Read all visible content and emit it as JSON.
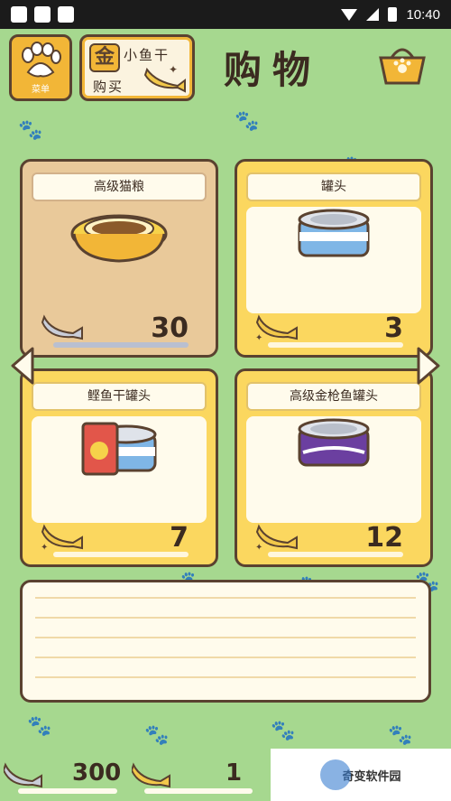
{
  "status_bar": {
    "time": "10:40"
  },
  "header": {
    "menu_label": "菜单",
    "buy_badge": "金",
    "buy_line1": "小鱼干",
    "buy_line2": "购买",
    "title": "购物"
  },
  "items": [
    {
      "name": "高级猫粮",
      "price": "30",
      "selected": true
    },
    {
      "name": "罐头",
      "price": "3",
      "selected": false
    },
    {
      "name": "鲣鱼干罐头",
      "price": "7",
      "selected": false
    },
    {
      "name": "高级金枪鱼罐头",
      "price": "12",
      "selected": false
    }
  ],
  "currency": {
    "silver_fish": "300",
    "gold_fish": "1"
  },
  "watermark": "奇变软件园",
  "colors": {
    "background": "#a6d88f",
    "card": "#fbd75f",
    "outline": "#5a4230",
    "accent": "#f2b637"
  }
}
